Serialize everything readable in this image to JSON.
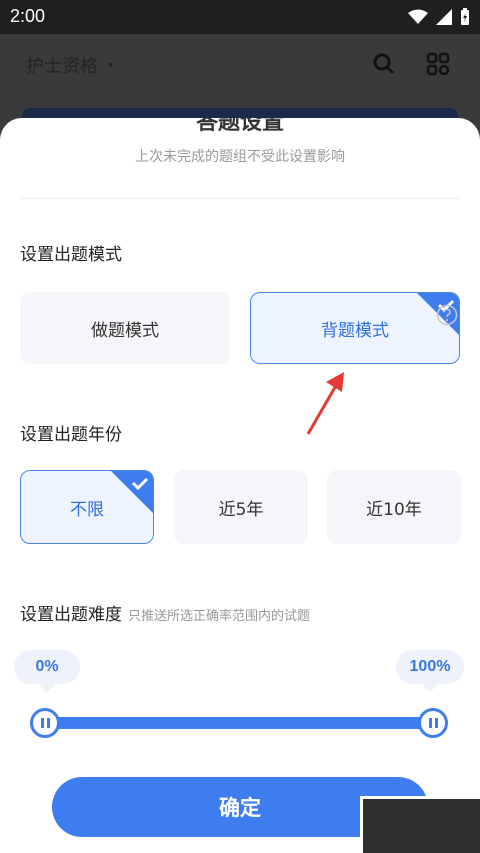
{
  "status_bar": {
    "time": "2:00"
  },
  "header": {
    "title": "护士资格"
  },
  "sheet": {
    "cut_title": "答题设置",
    "subtitle": "上次未完成的题组不受此设置影响",
    "mode_section": {
      "title": "设置出题模式",
      "options": [
        {
          "label": "做题模式",
          "selected": false
        },
        {
          "label": "背题模式",
          "selected": true
        }
      ]
    },
    "year_section": {
      "title": "设置出题年份",
      "options": [
        {
          "label": "不限",
          "selected": true
        },
        {
          "label": "近5年",
          "selected": false
        },
        {
          "label": "近10年",
          "selected": false
        }
      ]
    },
    "difficulty_section": {
      "title": "设置出题难度",
      "hint": "只推送所选正确率范围内的试题",
      "min_label": "0%",
      "max_label": "100%",
      "range": [
        0,
        100
      ]
    },
    "confirm_label": "确定"
  },
  "colors": {
    "accent": "#3e7df0",
    "selected_bg": "#eef4ff"
  }
}
